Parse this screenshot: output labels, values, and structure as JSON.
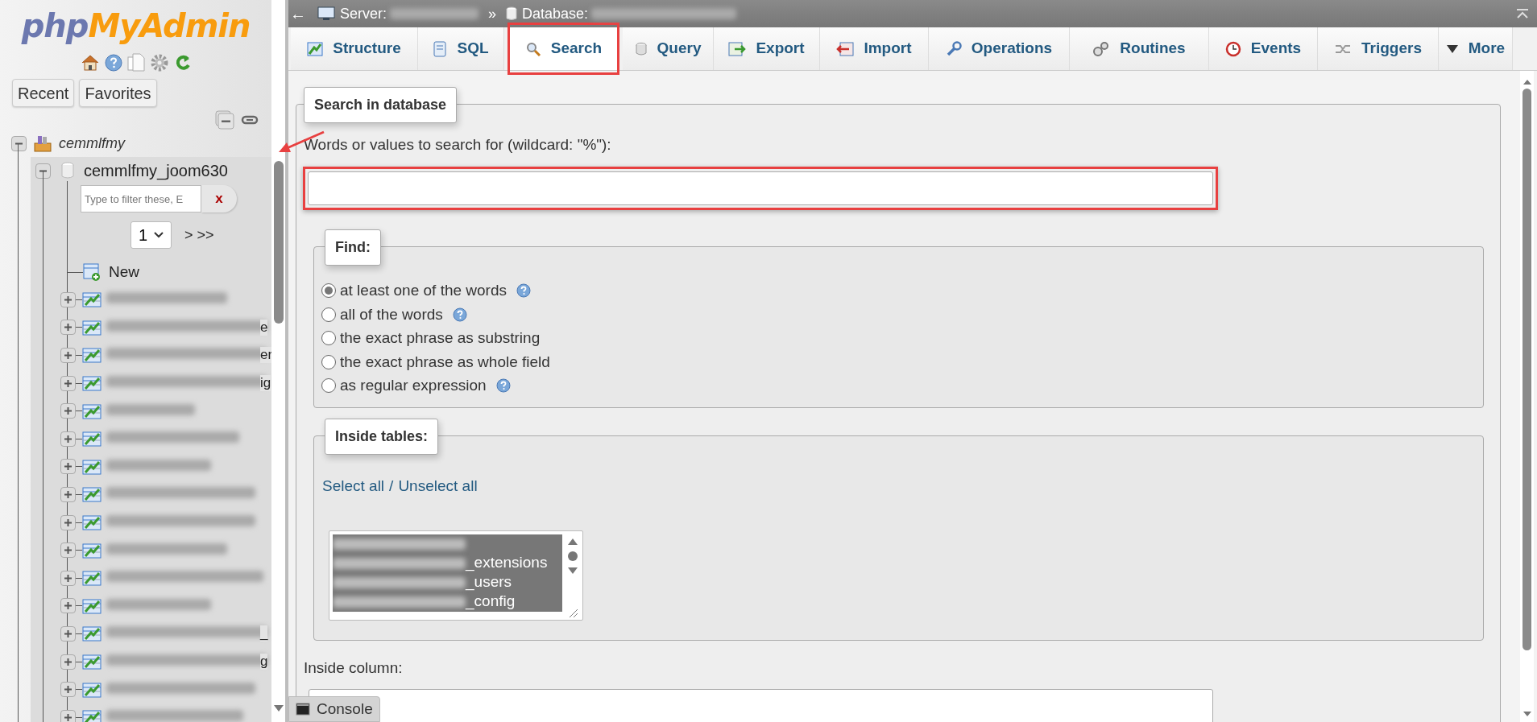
{
  "sidebar": {
    "logo": {
      "first": "php",
      "second": "MyAdmin"
    },
    "buttons": [
      "Recent",
      "Favorites"
    ],
    "tree": [
      {
        "label": "cemmlfmy",
        "expanded": true,
        "children": [
          {
            "label": "cemmlfmy_joom630",
            "expanded": true,
            "selected": true,
            "filter": {
              "placeholder": "Type to filter these, E",
              "clear": "x"
            },
            "pager": {
              "value": "1",
              "next": "> >>"
            },
            "new_label": "New",
            "tables": [
              {
                "expanded": false
              },
              {
                "tail": "e",
                "expanded": false
              },
              {
                "tail": "er",
                "expanded": false
              },
              {
                "tail": "ig",
                "expanded": false
              },
              {
                "expanded": false
              },
              {
                "expanded": false
              },
              {
                "expanded": false
              },
              {
                "expanded": false
              },
              {
                "expanded": false
              },
              {
                "expanded": false
              },
              {
                "expanded": false
              },
              {
                "expanded": false
              },
              {
                "tail": "_",
                "expanded": false
              },
              {
                "tail": "g",
                "expanded": false
              },
              {
                "expanded": false
              },
              {
                "expanded": false
              }
            ]
          }
        ]
      }
    ]
  },
  "breadcrumb": {
    "back": "←",
    "server_label": "Server:",
    "separator": "»",
    "database_label": "Database:"
  },
  "tabs": [
    {
      "label": "Structure",
      "selected": false
    },
    {
      "label": "SQL",
      "selected": false
    },
    {
      "label": "Search",
      "selected": true
    },
    {
      "label": "Query",
      "selected": false
    },
    {
      "label": "Export",
      "selected": false
    },
    {
      "label": "Import",
      "selected": false
    },
    {
      "label": "Operations",
      "selected": false
    },
    {
      "label": "Routines",
      "selected": false
    },
    {
      "label": "Events",
      "selected": false
    },
    {
      "label": "Triggers",
      "selected": false
    },
    {
      "label": "More",
      "selected": false
    }
  ],
  "search": {
    "legend": "Search in database",
    "words_label": "Words or values to search for (wildcard: \"%\"):",
    "find": {
      "legend": "Find:",
      "options": [
        {
          "label": "at least one of the words",
          "selected": true,
          "help": true
        },
        {
          "label": "all of the words",
          "selected": false,
          "help": true
        },
        {
          "label": "the exact phrase as substring",
          "selected": false,
          "help": false
        },
        {
          "label": "the exact phrase as whole field",
          "selected": false,
          "help": false
        },
        {
          "label": "as regular expression",
          "selected": false,
          "help": true
        }
      ]
    },
    "tables": {
      "legend": "Inside tables:",
      "select_all": "Select all",
      "divider": "/",
      "unselect_all": "Unselect all",
      "items": [
        {
          "selected": true
        },
        {
          "tail": "_extensions",
          "selected": true
        },
        {
          "tail": "_users",
          "selected": true
        },
        {
          "tail": "_config",
          "selected": true
        }
      ]
    },
    "column_label": "Inside column:"
  },
  "console": {
    "label": "Console"
  }
}
